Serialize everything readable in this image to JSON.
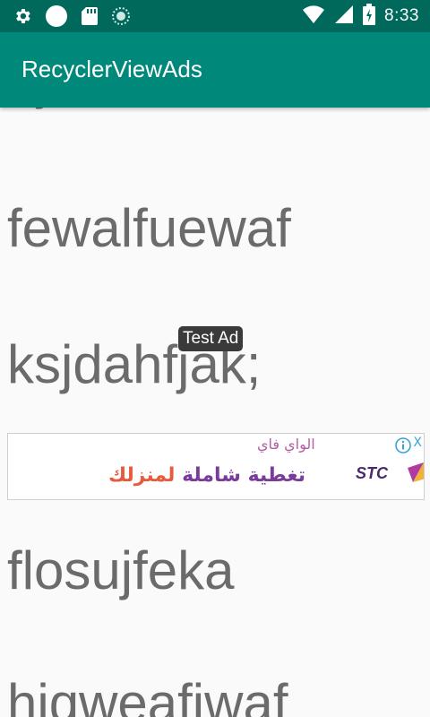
{
  "status_bar": {
    "time": "8:33",
    "icons": [
      "settings-icon",
      "circle-icon",
      "sd-card-icon",
      "sync-icon",
      "wifi-icon",
      "signal-icon",
      "battery-icon"
    ]
  },
  "app_bar": {
    "title": "RecyclerViewAds",
    "color": "#00897b",
    "status_color": "#00695c"
  },
  "list": {
    "items": [
      {
        "text": "fewalfuewaf"
      },
      {
        "text": "ksjdahfjak;"
      },
      {
        "text": "flosujfeka"
      },
      {
        "text": "hiqweafiwaf"
      }
    ],
    "text_color": "#6b6b6b"
  },
  "ad": {
    "label": "Test Ad",
    "headline": "الواي فاي",
    "body_main": "تغطية شاملة",
    "body_accent": "لمنزلك",
    "brand": "STC",
    "close_symbol": "X"
  }
}
